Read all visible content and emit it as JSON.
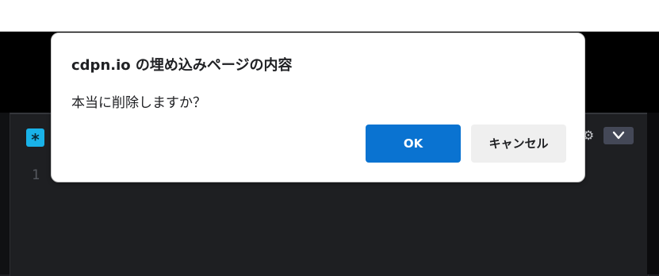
{
  "dialog": {
    "title": "cdpn.io の埋め込みページの内容",
    "message": "本当に削除しますか？",
    "ok_label": "OK",
    "cancel_label": "キャンセル"
  },
  "editor": {
    "language_badge": "*",
    "line_numbers": [
      "1"
    ],
    "icons": [
      "gear-icon",
      "chevron-down-icon"
    ]
  },
  "colors": {
    "ok_button": "#0a73d1",
    "cancel_button": "#efefef",
    "badge": "#19b2e8",
    "editor_background": "#1e1f22"
  }
}
